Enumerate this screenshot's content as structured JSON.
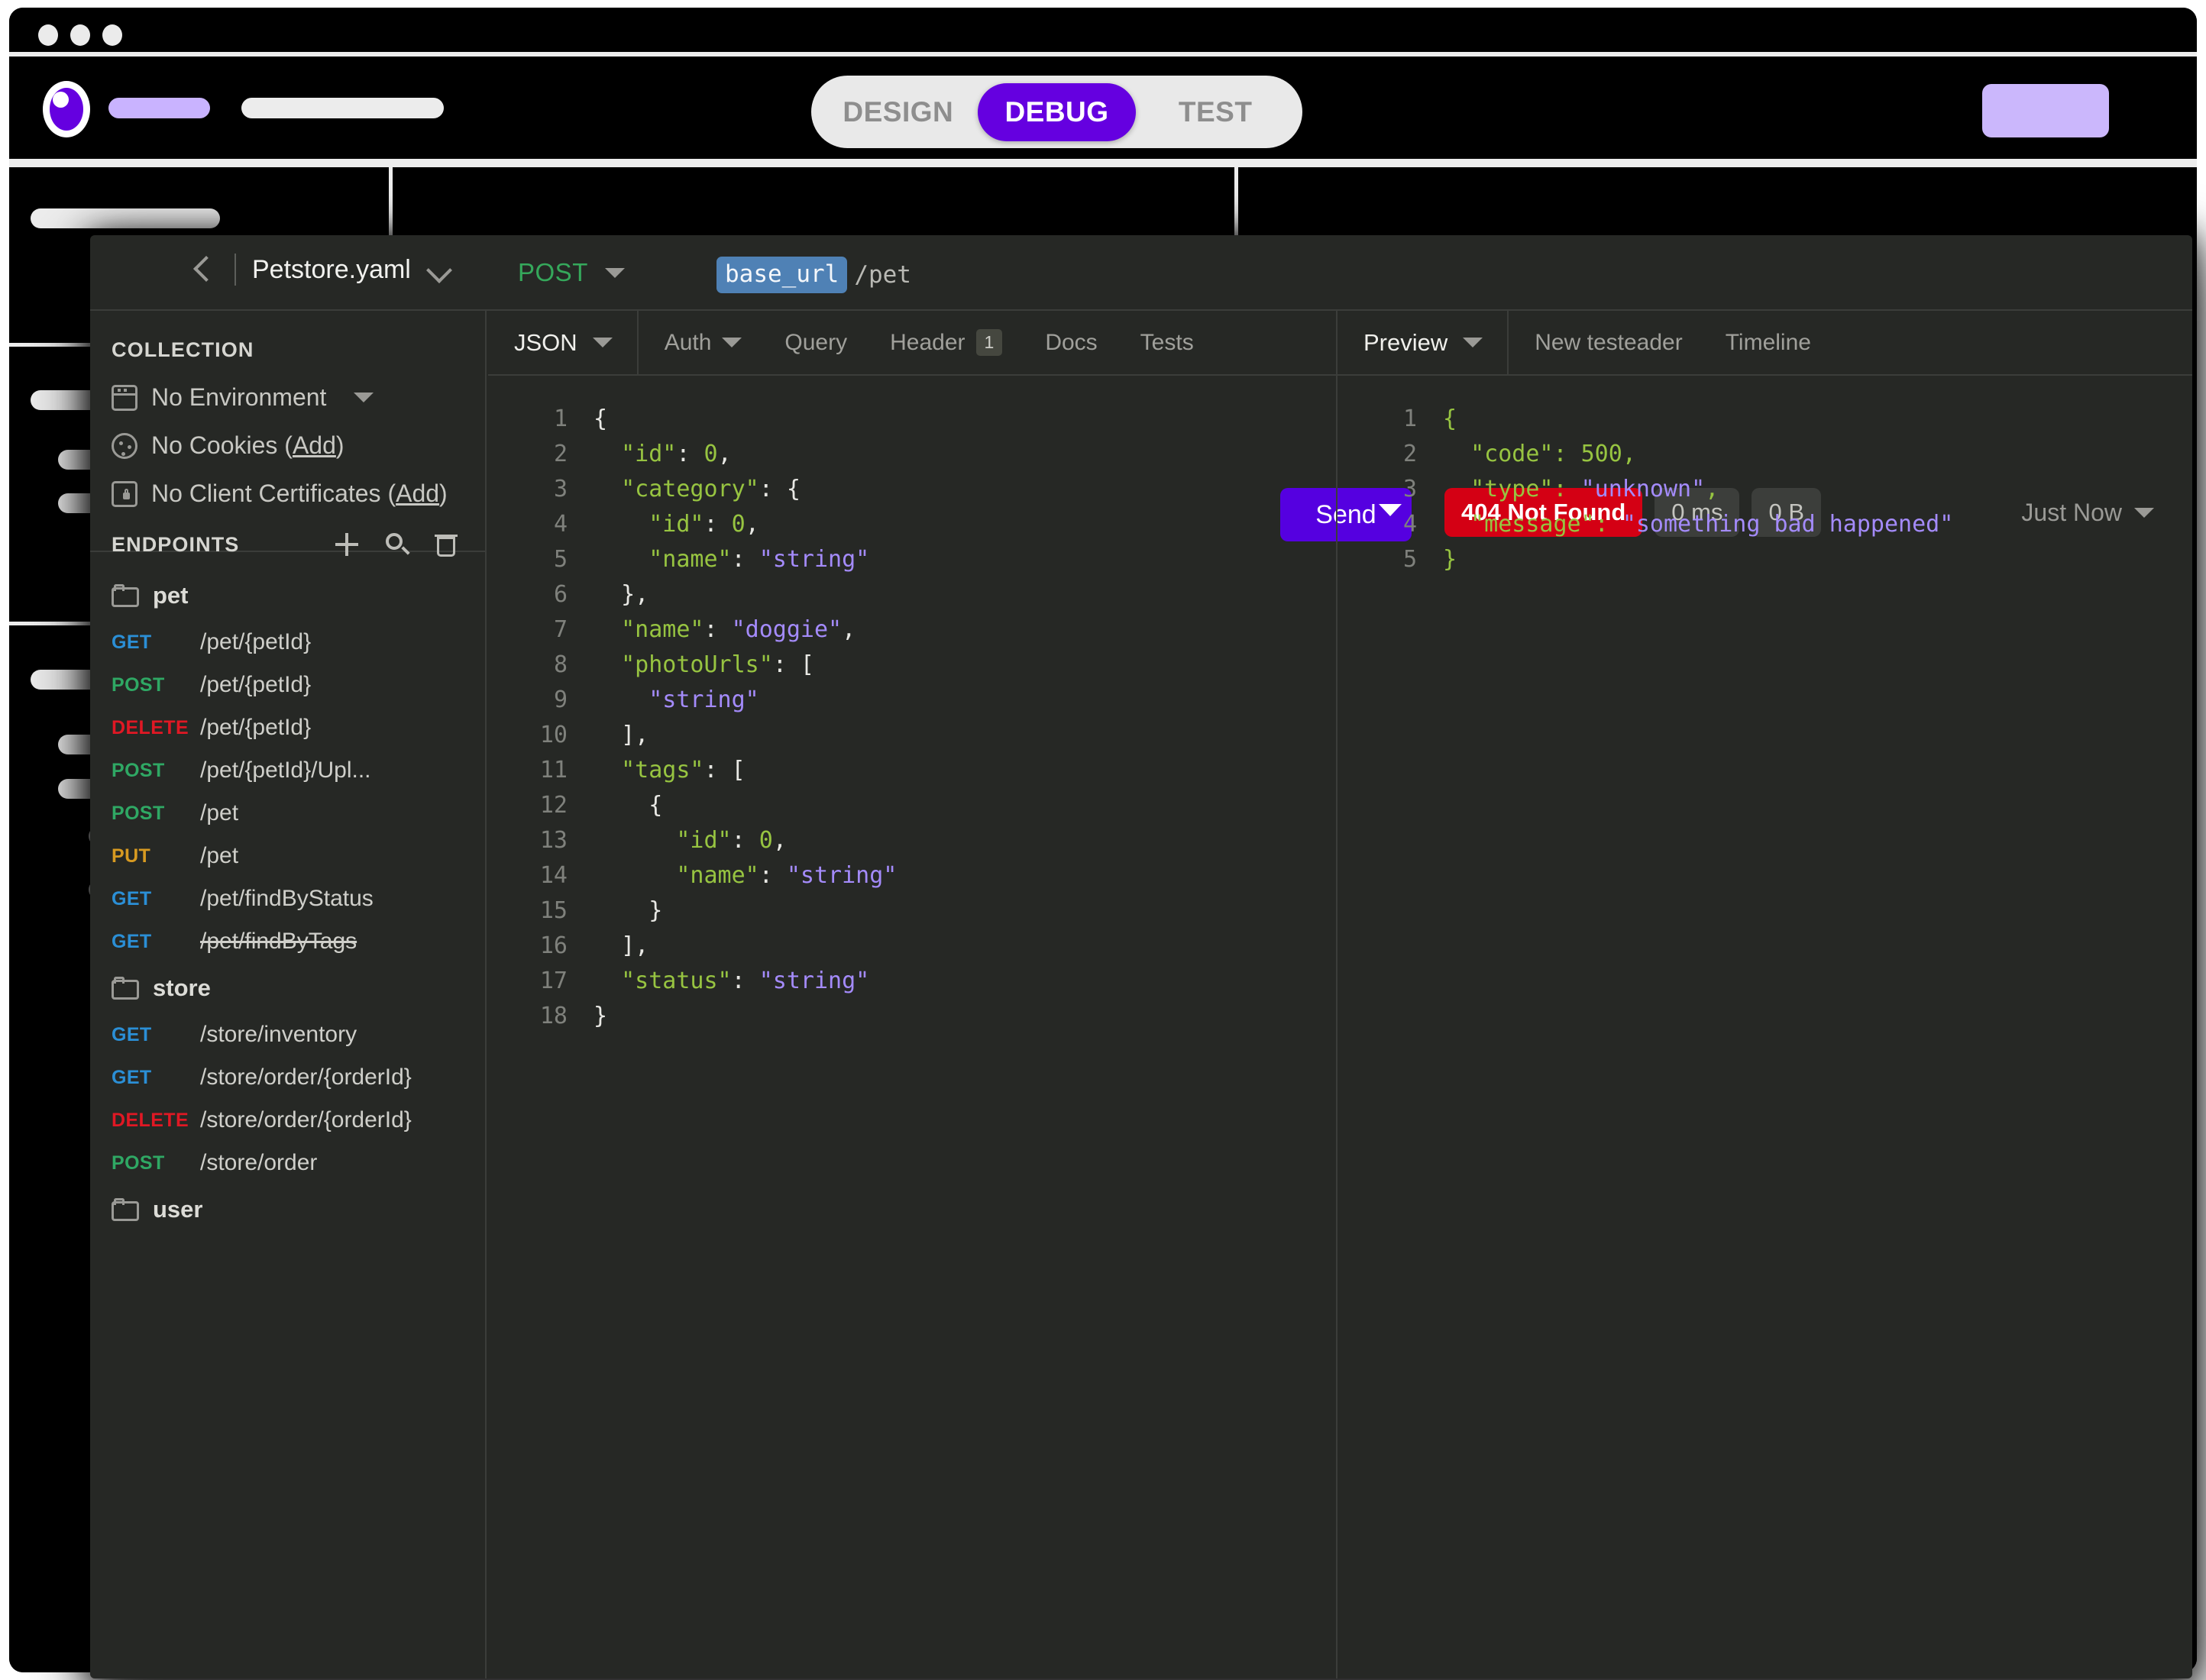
{
  "shell": {
    "window_dots": 3,
    "logo_icon": "brand-circle-logo",
    "nav_placeholder_primary": "",
    "nav_placeholder_secondary": "",
    "account_button_placeholder": "",
    "mode_toggle": {
      "options": [
        "DESIGN",
        "DEBUG",
        "TEST"
      ],
      "selected": "DEBUG",
      "accent": "#6500e0"
    }
  },
  "window": {
    "topbar": {
      "back_icon": "chevron-left-icon",
      "collection_title": "Petstore.yaml",
      "collection_caret": "chevron-down-icon",
      "method": "POST",
      "method_caret": "chevron-down-icon",
      "url_variable": "base_url",
      "url_path": "/pet",
      "send_label": "Send",
      "send_caret": "chevron-down-icon",
      "status_badge": "404 Not Found",
      "time_badge": "0 ms",
      "size_badge": "0 B",
      "history_label": "Just Now",
      "history_caret": "chevron-down-icon"
    },
    "sidebar": {
      "collection_label": "COLLECTION",
      "collection_rows": [
        {
          "icon": "environment-icon",
          "text": "No Environment",
          "caret": true,
          "link": ""
        },
        {
          "icon": "cookie-icon",
          "text": "No Cookies (",
          "link": "Add",
          "suffix": ")"
        },
        {
          "icon": "certificate-icon",
          "text": "No Client Certificates (",
          "link": "Add",
          "suffix": ")"
        }
      ],
      "endpoints_label": "ENDPOINTS",
      "endpoints_actions": [
        "add-icon",
        "search-icon",
        "trash-icon"
      ],
      "groups": [
        {
          "name": "pet",
          "items": [
            {
              "method": "GET",
              "path": "/pet/{petId}",
              "deprecated": false
            },
            {
              "method": "POST",
              "path": "/pet/{petId}",
              "deprecated": false
            },
            {
              "method": "DELETE",
              "path": "/pet/{petId}",
              "deprecated": false
            },
            {
              "method": "POST",
              "path": "/pet/{petId}/Upl...",
              "deprecated": false
            },
            {
              "method": "POST",
              "path": "/pet",
              "deprecated": false
            },
            {
              "method": "PUT",
              "path": "/pet",
              "deprecated": false
            },
            {
              "method": "GET",
              "path": "/pet/findByStatus",
              "deprecated": false
            },
            {
              "method": "GET",
              "path": "/pet/findByTags",
              "deprecated": true
            }
          ]
        },
        {
          "name": "store",
          "items": [
            {
              "method": "GET",
              "path": "/store/inventory",
              "deprecated": false
            },
            {
              "method": "GET",
              "path": "/store/order/{orderId}",
              "deprecated": false
            },
            {
              "method": "DELETE",
              "path": "/store/order/{orderId}",
              "deprecated": false
            },
            {
              "method": "POST",
              "path": "/store/order",
              "deprecated": false
            }
          ]
        },
        {
          "name": "user",
          "items": []
        }
      ]
    },
    "request": {
      "body_type": "JSON",
      "body_type_caret": "chevron-down-icon",
      "tabs": [
        {
          "label": "Auth",
          "caret": true,
          "badge": ""
        },
        {
          "label": "Query",
          "caret": false,
          "badge": ""
        },
        {
          "label": "Header",
          "caret": false,
          "badge": "1"
        },
        {
          "label": "Docs",
          "caret": false,
          "badge": ""
        },
        {
          "label": "Tests",
          "caret": false,
          "badge": ""
        }
      ],
      "body_lines": [
        {
          "n": "1",
          "tokens": [
            {
              "t": "{",
              "c": "p"
            }
          ]
        },
        {
          "n": "2",
          "tokens": [
            {
              "t": "  ",
              "c": "p"
            },
            {
              "t": "\"id\"",
              "c": "k"
            },
            {
              "t": ": ",
              "c": "p"
            },
            {
              "t": "0",
              "c": "n"
            },
            {
              "t": ",",
              "c": "p"
            }
          ]
        },
        {
          "n": "3",
          "tokens": [
            {
              "t": "  ",
              "c": "p"
            },
            {
              "t": "\"category\"",
              "c": "k"
            },
            {
              "t": ": {",
              "c": "p"
            }
          ]
        },
        {
          "n": "4",
          "tokens": [
            {
              "t": "    ",
              "c": "p"
            },
            {
              "t": "\"id\"",
              "c": "k"
            },
            {
              "t": ": ",
              "c": "p"
            },
            {
              "t": "0",
              "c": "n"
            },
            {
              "t": ",",
              "c": "p"
            }
          ]
        },
        {
          "n": "5",
          "tokens": [
            {
              "t": "    ",
              "c": "p"
            },
            {
              "t": "\"name\"",
              "c": "k"
            },
            {
              "t": ": ",
              "c": "p"
            },
            {
              "t": "\"string\"",
              "c": "s"
            }
          ]
        },
        {
          "n": "6",
          "tokens": [
            {
              "t": "  },",
              "c": "p"
            }
          ]
        },
        {
          "n": "7",
          "tokens": [
            {
              "t": "  ",
              "c": "p"
            },
            {
              "t": "\"name\"",
              "c": "k"
            },
            {
              "t": ": ",
              "c": "p"
            },
            {
              "t": "\"doggie\"",
              "c": "s"
            },
            {
              "t": ",",
              "c": "p"
            }
          ]
        },
        {
          "n": "8",
          "tokens": [
            {
              "t": "  ",
              "c": "p"
            },
            {
              "t": "\"photoUrls\"",
              "c": "k"
            },
            {
              "t": ": [",
              "c": "p"
            }
          ]
        },
        {
          "n": "9",
          "tokens": [
            {
              "t": "    ",
              "c": "p"
            },
            {
              "t": "\"string\"",
              "c": "s"
            }
          ]
        },
        {
          "n": "10",
          "tokens": [
            {
              "t": "  ],",
              "c": "p"
            }
          ]
        },
        {
          "n": "11",
          "tokens": [
            {
              "t": "  ",
              "c": "p"
            },
            {
              "t": "\"tags\"",
              "c": "k"
            },
            {
              "t": ": [",
              "c": "p"
            }
          ]
        },
        {
          "n": "12",
          "tokens": [
            {
              "t": "    {",
              "c": "p"
            }
          ]
        },
        {
          "n": "13",
          "tokens": [
            {
              "t": "      ",
              "c": "p"
            },
            {
              "t": "\"id\"",
              "c": "k"
            },
            {
              "t": ": ",
              "c": "p"
            },
            {
              "t": "0",
              "c": "n"
            },
            {
              "t": ",",
              "c": "p"
            }
          ]
        },
        {
          "n": "14",
          "tokens": [
            {
              "t": "      ",
              "c": "p"
            },
            {
              "t": "\"name\"",
              "c": "k"
            },
            {
              "t": ": ",
              "c": "p"
            },
            {
              "t": "\"string\"",
              "c": "s"
            }
          ]
        },
        {
          "n": "15",
          "tokens": [
            {
              "t": "    }",
              "c": "p"
            }
          ]
        },
        {
          "n": "16",
          "tokens": [
            {
              "t": "  ],",
              "c": "p"
            }
          ]
        },
        {
          "n": "17",
          "tokens": [
            {
              "t": "  ",
              "c": "p"
            },
            {
              "t": "\"status\"",
              "c": "k"
            },
            {
              "t": ": ",
              "c": "p"
            },
            {
              "t": "\"string\"",
              "c": "s"
            }
          ]
        },
        {
          "n": "18",
          "tokens": [
            {
              "t": "}",
              "c": "p"
            }
          ]
        }
      ]
    },
    "response": {
      "view": "Preview",
      "view_caret": "chevron-down-icon",
      "tabs": [
        "New testeader",
        "Timeline"
      ],
      "body_lines": [
        {
          "n": "1",
          "tokens": [
            {
              "t": "{",
              "c": "pg"
            }
          ]
        },
        {
          "n": "2",
          "tokens": [
            {
              "t": "  ",
              "c": "p"
            },
            {
              "t": "\"code\"",
              "c": "k"
            },
            {
              "t": ": ",
              "c": "pg"
            },
            {
              "t": "500",
              "c": "n"
            },
            {
              "t": ",",
              "c": "pg"
            }
          ]
        },
        {
          "n": "3",
          "tokens": [
            {
              "t": "  ",
              "c": "p"
            },
            {
              "t": "\"type\"",
              "c": "k"
            },
            {
              "t": ": ",
              "c": "pg"
            },
            {
              "t": "\"unknown\"",
              "c": "s"
            },
            {
              "t": ",",
              "c": "pg"
            }
          ]
        },
        {
          "n": "4",
          "tokens": [
            {
              "t": "  ",
              "c": "p"
            },
            {
              "t": "\"message\"",
              "c": "k"
            },
            {
              "t": ": ",
              "c": "pg"
            },
            {
              "t": "\"something bad happened\"",
              "c": "s"
            }
          ]
        },
        {
          "n": "5",
          "tokens": [
            {
              "t": "}",
              "c": "pg"
            }
          ]
        }
      ]
    }
  }
}
